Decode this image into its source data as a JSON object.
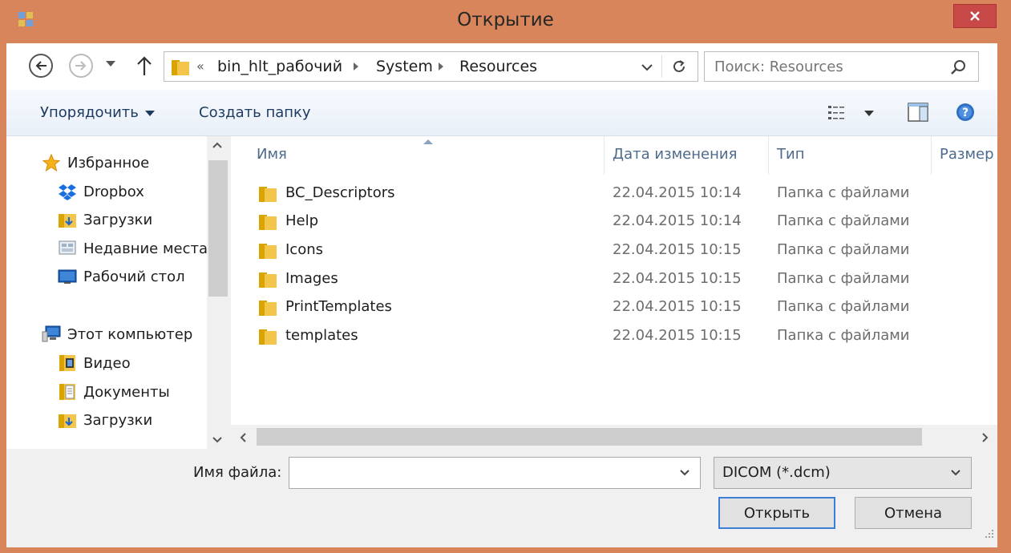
{
  "window": {
    "title": "Открытие",
    "icons": {
      "app": "app-icon",
      "close": "close-icon"
    }
  },
  "nav": {
    "back": "back-arrow-icon",
    "forward": "forward-arrow-icon",
    "recent": "chevron-down-icon",
    "up": "up-arrow-icon"
  },
  "address": {
    "overflow": "«",
    "crumbs": [
      "bin_hlt_рабочий",
      "System",
      "Resources"
    ],
    "icons": {
      "folder": "folder-icon",
      "dropdown": "chevron-down-icon",
      "refresh": "refresh-icon"
    }
  },
  "search": {
    "placeholder": "Поиск: Resources",
    "icon": "search-icon"
  },
  "toolbar": {
    "organize": "Упорядочить",
    "new_folder": "Создать папку",
    "icons": {
      "view": "view-list-icon",
      "preview_pane": "preview-pane-icon",
      "help": "help-icon"
    }
  },
  "sidebar": {
    "items": [
      {
        "label": "Избранное",
        "icon": "star-icon"
      },
      {
        "label": "Dropbox",
        "icon": "dropbox-icon"
      },
      {
        "label": "Загрузки",
        "icon": "downloads-icon"
      },
      {
        "label": "Недавние места",
        "icon": "recent-places-icon"
      },
      {
        "label": "Рабочий стол",
        "icon": "desktop-icon"
      },
      {
        "label": "Этот компьютер",
        "icon": "computer-icon"
      },
      {
        "label": "Видео",
        "icon": "video-icon"
      },
      {
        "label": "Документы",
        "icon": "documents-icon"
      },
      {
        "label": "Загрузки",
        "icon": "downloads-icon"
      }
    ]
  },
  "files": {
    "columns": [
      "Имя",
      "Дата изменения",
      "Тип",
      "Размер"
    ],
    "rows": [
      {
        "name": "BC_Descriptors",
        "date": "22.04.2015 10:14",
        "type": "Папка с файлами"
      },
      {
        "name": "Help",
        "date": "22.04.2015 10:14",
        "type": "Папка с файлами"
      },
      {
        "name": "Icons",
        "date": "22.04.2015 10:15",
        "type": "Папка с файлами"
      },
      {
        "name": "Images",
        "date": "22.04.2015 10:15",
        "type": "Папка с файлами"
      },
      {
        "name": "PrintTemplates",
        "date": "22.04.2015 10:15",
        "type": "Папка с файлами"
      },
      {
        "name": "templates",
        "date": "22.04.2015 10:15",
        "type": "Папка с файлами"
      }
    ]
  },
  "footer": {
    "filename_label": "Имя файла:",
    "filename_value": "",
    "filter": "DICOM (*.dcm)",
    "open": "Открыть",
    "cancel": "Отмена"
  },
  "colors": {
    "frame": "#d9855c",
    "close": "#c84848",
    "accent": "#3c7fd9"
  }
}
